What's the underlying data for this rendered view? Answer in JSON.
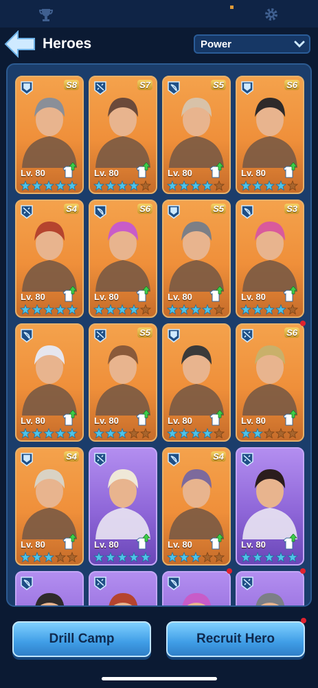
{
  "header": {
    "title": "Heroes",
    "sort_label": "Power"
  },
  "heroes": [
    {
      "grade": "S8",
      "level": "Lv. 80",
      "role": "shield",
      "card": "orange",
      "stars": 5,
      "notify": false
    },
    {
      "grade": "S7",
      "level": "Lv. 80",
      "role": "sword",
      "card": "orange",
      "stars": 4,
      "notify": false
    },
    {
      "grade": "S5",
      "level": "Lv. 80",
      "role": "bow",
      "card": "orange",
      "stars": 4,
      "notify": false
    },
    {
      "grade": "S6",
      "level": "Lv. 80",
      "role": "shield",
      "card": "orange",
      "stars": 4,
      "notify": false
    },
    {
      "grade": "S4",
      "level": "Lv. 80",
      "role": "sword",
      "card": "orange",
      "stars": 5,
      "notify": false
    },
    {
      "grade": "S6",
      "level": "Lv. 80",
      "role": "bow",
      "card": "orange",
      "stars": 4,
      "notify": false
    },
    {
      "grade": "S5",
      "level": "Lv. 80",
      "role": "shield",
      "card": "orange",
      "stars": 4,
      "notify": false
    },
    {
      "grade": "S3",
      "level": "Lv. 80",
      "role": "bow",
      "card": "orange",
      "stars": 4,
      "notify": false
    },
    {
      "grade": "",
      "level": "Lv. 80",
      "role": "bow",
      "card": "orange",
      "stars": 5,
      "notify": false
    },
    {
      "grade": "S5",
      "level": "Lv. 80",
      "role": "sword",
      "card": "orange",
      "stars": 3,
      "notify": false
    },
    {
      "grade": "",
      "level": "Lv. 80",
      "role": "shield",
      "card": "orange",
      "stars": 4,
      "notify": false
    },
    {
      "grade": "S6",
      "level": "Lv. 80",
      "role": "sword",
      "card": "orange",
      "stars": 2,
      "notify": true
    },
    {
      "grade": "S4",
      "level": "Lv. 80",
      "role": "shield",
      "card": "orange",
      "stars": 3,
      "notify": false
    },
    {
      "grade": "",
      "level": "Lv. 80",
      "role": "sword",
      "card": "purple",
      "stars": 5,
      "notify": false
    },
    {
      "grade": "S4",
      "level": "Lv. 80",
      "role": "bow",
      "card": "orange",
      "stars": 3,
      "notify": false
    },
    {
      "grade": "",
      "level": "Lv. 80",
      "role": "sword",
      "card": "purple",
      "stars": 5,
      "notify": false
    }
  ],
  "partial_row": [
    {
      "role": "bow",
      "card": "purple",
      "notify": false
    },
    {
      "role": "sword",
      "card": "purple",
      "notify": false
    },
    {
      "role": "bow",
      "card": "purple",
      "notify": true
    },
    {
      "role": "sword",
      "card": "purple",
      "notify": true
    }
  ],
  "buttons": {
    "drill_camp": "Drill Camp",
    "recruit_hero": "Recruit Hero"
  },
  "colors": {
    "bg": "#0b1a33",
    "panel": "#1b3d6b",
    "star": "#4fc3e8",
    "accent": "#3f9de6"
  }
}
